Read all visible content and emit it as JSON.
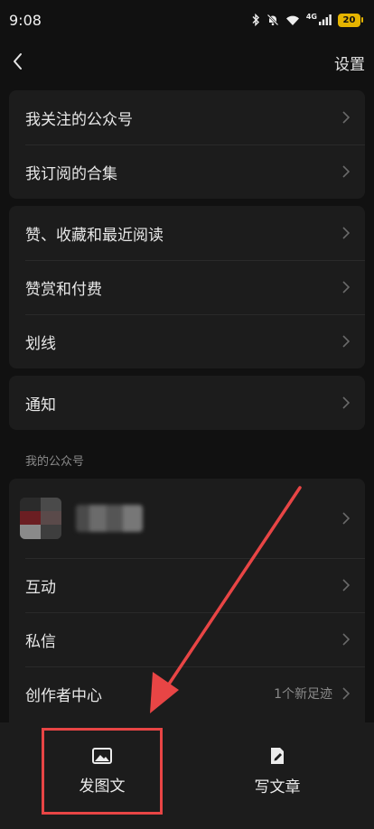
{
  "status_bar": {
    "time": "9:08",
    "network_label": "4G",
    "battery": "20"
  },
  "nav": {
    "settings_label": "设置"
  },
  "group1": [
    {
      "label": "我关注的公众号"
    },
    {
      "label": "我订阅的合集"
    }
  ],
  "group2": [
    {
      "label": "赞、收藏和最近阅读"
    },
    {
      "label": "赞赏和付费"
    },
    {
      "label": "划线"
    }
  ],
  "group3": [
    {
      "label": "通知"
    }
  ],
  "my_accounts": {
    "section_title": "我的公众号",
    "rows": [
      {
        "label": "互动"
      },
      {
        "label": "私信"
      },
      {
        "label": "创作者中心",
        "extra": "1个新足迹"
      }
    ]
  },
  "bottom_bar": {
    "post_label": "发图文",
    "write_label": "写文章"
  },
  "colors": {
    "background": "#111111",
    "card": "#1c1c1c",
    "highlight": "#e84545",
    "battery": "#e5b400"
  }
}
